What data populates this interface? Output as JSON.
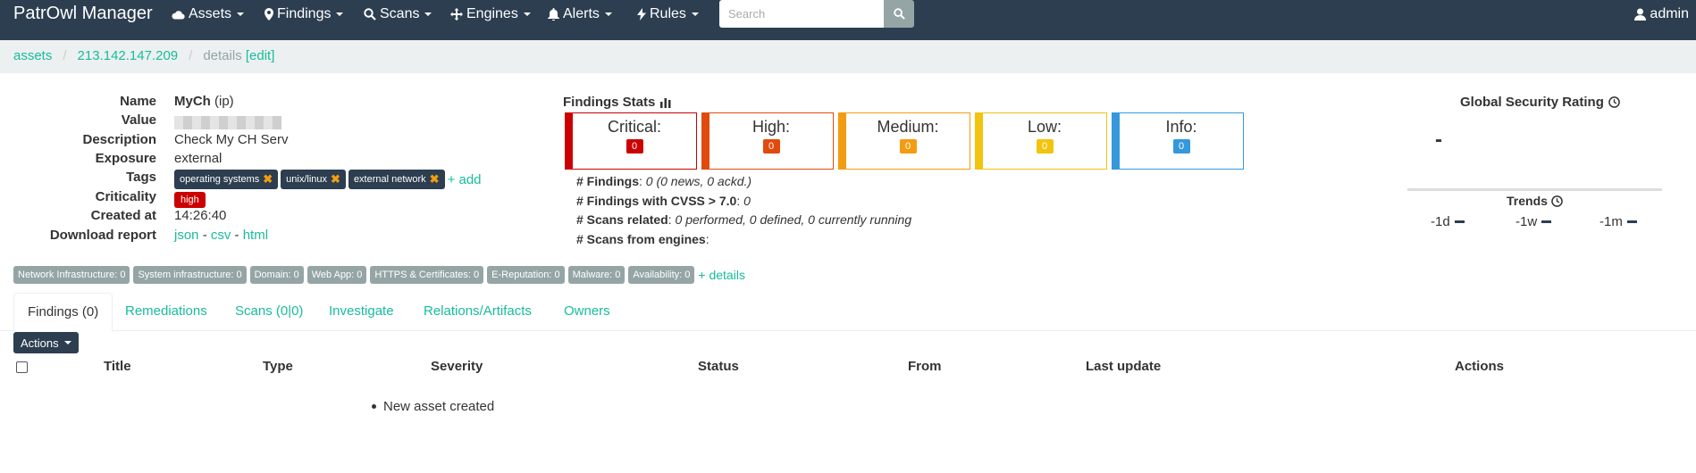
{
  "nav": {
    "brand": "PatrOwl Manager",
    "items": [
      {
        "label": "Assets",
        "icon": "cloud-icon"
      },
      {
        "label": "Findings",
        "icon": "map-marker-icon"
      },
      {
        "label": "Scans",
        "icon": "search-icon"
      },
      {
        "label": "Engines",
        "icon": "move-icon"
      },
      {
        "label": "Alerts",
        "icon": "bell-icon"
      },
      {
        "label": "Rules",
        "icon": "flash-icon"
      }
    ],
    "search_placeholder": "Search",
    "user": "admin"
  },
  "breadcrumb": {
    "assets": "assets",
    "asset": "213.142.147.209",
    "details": "details",
    "edit": "[edit]"
  },
  "asset": {
    "labels": {
      "name": "Name",
      "value": "Value",
      "description": "Description",
      "exposure": "Exposure",
      "tags": "Tags",
      "criticality": "Criticality",
      "created_at": "Created at",
      "download_report": "Download report"
    },
    "name": "MyCh",
    "type": "(ip)",
    "description": "Check My CH Serv",
    "exposure": "external",
    "tags": [
      "operating systems",
      "unix/linux",
      "external network"
    ],
    "add_tag": "+ add",
    "criticality": "high",
    "created_at": "14:26:40",
    "reports": {
      "json": "json",
      "csv": "csv",
      "html": "html",
      "sep": "-"
    }
  },
  "findings_stats": {
    "title": "Findings Stats",
    "boxes": [
      {
        "label": "Critical:",
        "count": "0",
        "color": "#cc0000"
      },
      {
        "label": "High:",
        "count": "0",
        "color": "#e04a0f"
      },
      {
        "label": "Medium:",
        "count": "0",
        "color": "#f39c12"
      },
      {
        "label": "Low:",
        "count": "0",
        "color": "#f1c40f"
      },
      {
        "label": "Info:",
        "count": "0",
        "color": "#3498db"
      }
    ],
    "lines": [
      {
        "label": "# Findings",
        "value": "0 (0 news, 0 ackd.)"
      },
      {
        "label": "# Findings with CVSS > 7.0",
        "value": "0"
      },
      {
        "label": "# Scans related",
        "value": "0 performed, 0 defined, 0 currently running"
      },
      {
        "label": "# Scans from engines",
        "value": ""
      }
    ]
  },
  "rating": {
    "title": "Global Security Rating",
    "value": "-",
    "trends_title": "Trends",
    "trends": [
      "-1d",
      "-1w",
      "-1m"
    ]
  },
  "categories": [
    "Network Infrastructure: 0",
    "System infrastructure: 0",
    "Domain: 0",
    "Web App: 0",
    "HTTPS & Certificates: 0",
    "E-Reputation: 0",
    "Malware: 0",
    "Availability: 0"
  ],
  "categories_details": "+ details",
  "tabs": [
    "Findings (0)",
    "Remediations",
    "Scans (0|0)",
    "Investigate",
    "Relations/Artifacts",
    "Owners"
  ],
  "table": {
    "actions_button": "Actions",
    "columns": [
      "Title",
      "Type",
      "Severity",
      "Status",
      "From",
      "Last update",
      "Actions"
    ],
    "empty_message": "New asset created"
  }
}
